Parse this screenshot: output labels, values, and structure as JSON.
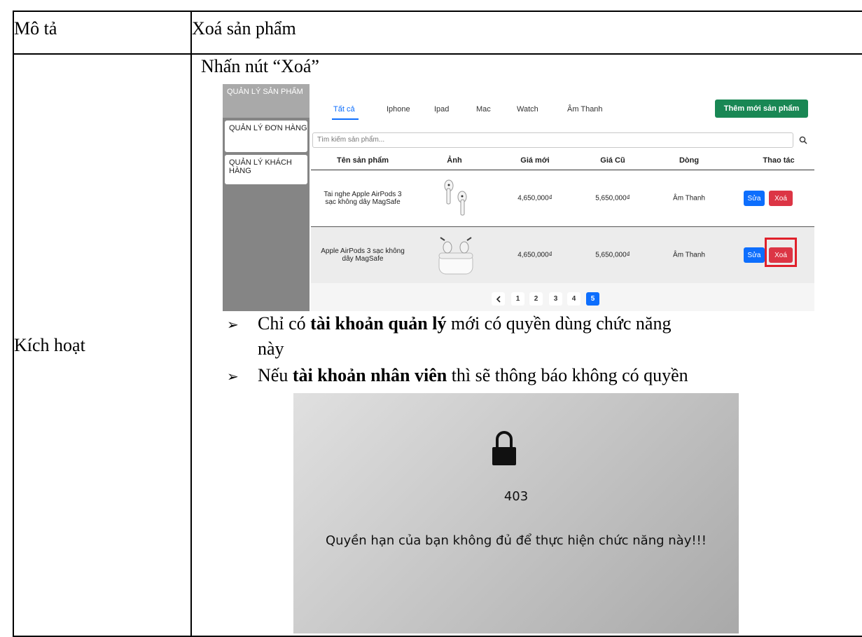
{
  "row1": {
    "label": "Mô tả",
    "value": "Xoá sản phẩm"
  },
  "row2": {
    "label": "Kích hoạt",
    "step": "Nhấn nút “Xoá”"
  },
  "admin": {
    "sidebar": [
      {
        "label": "QUẢN LÝ SẢN PHẨM"
      },
      {
        "label": "QUẢN LÝ ĐƠN HÀNG"
      },
      {
        "label": "QUẢN LÝ KHÁCH HÀNG"
      }
    ],
    "tabs": [
      "Tất cả",
      "Iphone",
      "Ipad",
      "Mac",
      "Watch",
      "Âm Thanh"
    ],
    "add_button": "Thêm mới sản phẩm",
    "search_placeholder": "Tìm kiếm sản phẩm...",
    "columns": [
      "Tên sản phẩm",
      "Ảnh",
      "Giá mới",
      "Giá Cũ",
      "Dòng",
      "Thao tác"
    ],
    "rows": [
      {
        "name_line1": "Tai nghe Apple AirPods 3",
        "name_line2": "sạc không dây MagSafe",
        "new_price": "4,650,000₫",
        "old_price": "5,650,000₫",
        "line": "Âm Thanh",
        "edit": "Sửa",
        "delete": "Xoá"
      },
      {
        "name_line1": "Apple AirPods 3 sạc không",
        "name_line2": "dây MagSafe",
        "new_price": "4,650,000₫",
        "old_price": "5,650,000₫",
        "line": "Âm Thanh",
        "edit": "Sửa",
        "delete": "Xoá"
      }
    ],
    "pages": [
      "1",
      "2",
      "3",
      "4",
      "5"
    ],
    "current_page": "5",
    "prev_icon": "chevron-left-icon",
    "colors": {
      "green": "#198754",
      "blue": "#0d6efd",
      "red": "#dc3545",
      "highlight": "#e0202a"
    }
  },
  "bullets": {
    "b1_pre": "Chỉ có ",
    "b1_bold": "tài khoản quản lý",
    "b1_post": " mới có quyền dùng chức năng",
    "b1_cont": "này",
    "b2_pre": "Nếu ",
    "b2_bold": "tài khoản nhân viên",
    "b2_post": " thì sẽ thông báo không có quyền"
  },
  "denied": {
    "icon": "lock-icon",
    "code": "403",
    "message": "Quyền hạn của bạn không đủ để thực hiện chức năng này!!!"
  }
}
